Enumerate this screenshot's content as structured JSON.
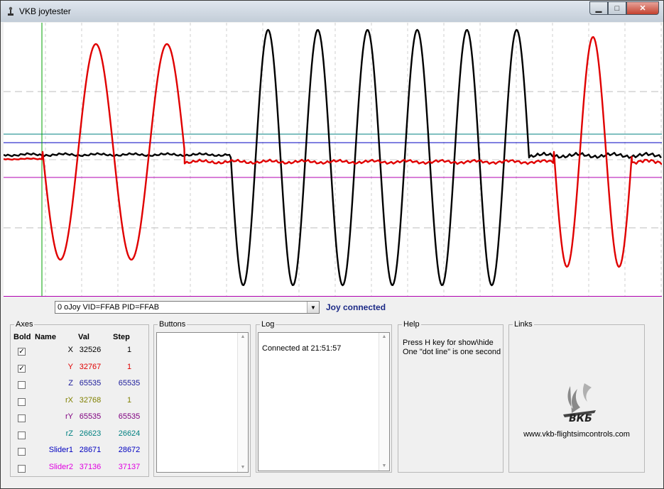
{
  "window": {
    "title": "VKB joytester",
    "controls": {
      "minimize": "▁",
      "maximize": "□",
      "close": "✕"
    }
  },
  "device": {
    "selected": "0 oJoy VID=FFAB PID=FFAB",
    "status": "Joy connected"
  },
  "axes": {
    "group_label": "Axes",
    "headers": {
      "bold": "Bold",
      "name": "Name",
      "val": "Val",
      "step": "Step"
    },
    "rows": [
      {
        "checked": true,
        "name": "X",
        "val": "32526",
        "step": "1",
        "color": "#000000"
      },
      {
        "checked": true,
        "name": "Y",
        "val": "32767",
        "step": "1",
        "color": "#e00000"
      },
      {
        "checked": false,
        "name": "Z",
        "val": "65535",
        "step": "65535",
        "color": "#1a1a9a"
      },
      {
        "checked": false,
        "name": "rX",
        "val": "32768",
        "step": "1",
        "color": "#808000"
      },
      {
        "checked": false,
        "name": "rY",
        "val": "65535",
        "step": "65535",
        "color": "#800080"
      },
      {
        "checked": false,
        "name": "rZ",
        "val": "26623",
        "step": "26624",
        "color": "#008080"
      },
      {
        "checked": false,
        "name": "Slider1",
        "val": "28671",
        "step": "28672",
        "color": "#0000c0"
      },
      {
        "checked": false,
        "name": "Slider2",
        "val": "37136",
        "step": "37137",
        "color": "#e000e0"
      }
    ]
  },
  "buttons": {
    "group_label": "Buttons"
  },
  "log": {
    "group_label": "Log",
    "lines": [
      "Connected at 21:51:57"
    ]
  },
  "help": {
    "group_label": "Help",
    "line1": "Press H key for show\\hide",
    "line2": "One \"dot line\" is one second"
  },
  "links": {
    "group_label": "Links",
    "logo_text": "ВКБ",
    "url": "www.vkb-flightsimcontrols.com"
  },
  "colors": {
    "x_trace": "#000000",
    "y_trace": "#e00000",
    "rz_line": "#008080",
    "slider1_line": "#0000c0",
    "ry_line": "#b000b0",
    "cursor_line": "#00a000"
  }
}
